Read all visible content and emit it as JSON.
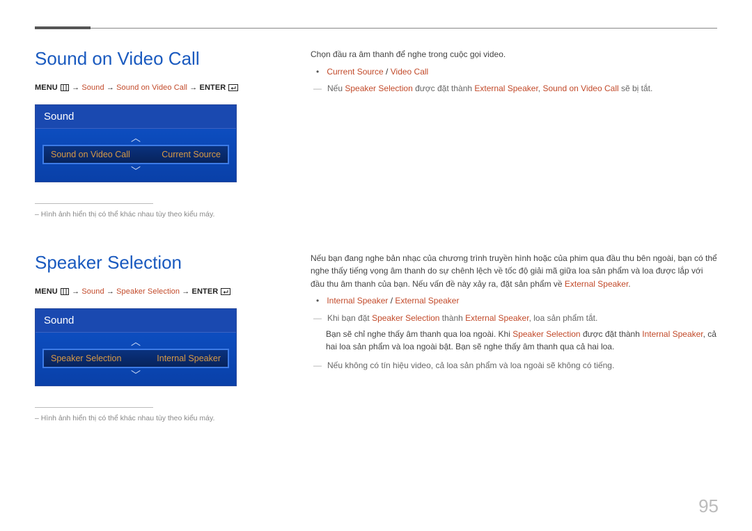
{
  "page_number": "95",
  "section1": {
    "title": "Sound on Video Call",
    "menu_path": {
      "prefix": "MENU",
      "p1": "Sound",
      "p2": "Sound on Video Call",
      "suffix": "ENTER"
    },
    "screenshot": {
      "header": "Sound",
      "row_label": "Sound on Video Call",
      "row_value": "Current Source"
    },
    "caption": "Hình ảnh hiển thị có thể khác nhau tùy theo kiểu máy.",
    "right": {
      "intro": "Chọn đầu ra âm thanh để nghe trong cuộc gọi video.",
      "bullet_a": "Current Source",
      "bullet_sep": " / ",
      "bullet_b": "Video Call",
      "note_pre": "Nếu ",
      "note_hl1": "Speaker Selection",
      "note_mid": " được đặt thành ",
      "note_hl2": "External Speaker",
      "note_sep": ", ",
      "note_hl3": "Sound on Video Call",
      "note_end": " sẽ bị tắt."
    }
  },
  "section2": {
    "title": "Speaker Selection",
    "menu_path": {
      "prefix": "MENU",
      "p1": "Sound",
      "p2": "Speaker Selection",
      "suffix": "ENTER"
    },
    "screenshot": {
      "header": "Sound",
      "row_label": "Speaker Selection",
      "row_value": "Internal Speaker"
    },
    "caption": "Hình ảnh hiển thị có thể khác nhau tùy theo kiểu máy.",
    "right": {
      "para_a": "Nếu bạn đang nghe bản nhạc của chương trình truyền hình hoặc của phim qua đầu thu bên ngoài, bạn có thể nghe thấy tiếng vọng âm thanh do sự chênh lệch về tốc độ giải mã giữa loa sản phẩm và loa được lắp với đầu thu âm thanh của bạn. Nếu vấn đề này xảy ra, đặt sản phẩm về ",
      "para_a_hl": "External Speaker",
      "para_a_end": ".",
      "bullet_a": "Internal Speaker",
      "bullet_sep": " / ",
      "bullet_b": "External Speaker",
      "note1_pre": "Khi bạn đặt ",
      "note1_hl1": "Speaker Selection",
      "note1_mid1": " thành ",
      "note1_hl2": "External Speaker",
      "note1_end": ", loa sản phẩm tắt.",
      "note1b_pre": "Bạn sẽ chỉ nghe thấy âm thanh qua loa ngoài. Khi ",
      "note1b_hl1": "Speaker Selection",
      "note1b_mid": " được đặt thành ",
      "note1b_hl2": "Internal Speaker",
      "note1b_end": ", cả hai loa sản phẩm và loa ngoài bật. Bạn sẽ nghe thấy âm thanh qua cả hai loa.",
      "note2": "Nếu không có tín hiệu video, cả loa sản phẩm và loa ngoài sẽ không có tiếng."
    }
  }
}
